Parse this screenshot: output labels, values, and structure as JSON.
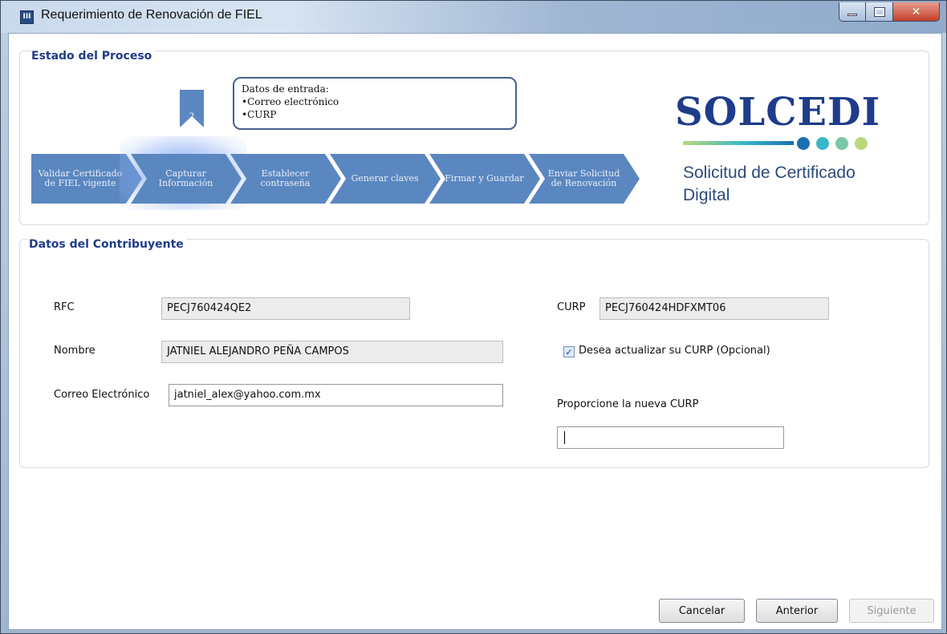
{
  "window": {
    "title": "Requerimiento de Renovación de FIEL",
    "icon_text": "III"
  },
  "process": {
    "group_title": "Estado del Proceso",
    "step_number": "2",
    "callout": {
      "heading": "Datos de entrada:",
      "items": [
        "Correo electrónico",
        "CURP"
      ]
    },
    "steps": [
      {
        "label": "Validar Certificado de FIEL vigente"
      },
      {
        "label": "Capturar Información"
      },
      {
        "label": "Establecer contraseña"
      },
      {
        "label": "Generar claves"
      },
      {
        "label": "Firmar y Guardar"
      },
      {
        "label": "Enviar Solicitud de Renovación"
      }
    ],
    "active_step": 2
  },
  "logo": {
    "word": "SOLCEDI",
    "sub1": "Solicitud de Certificado",
    "sub2": "Digital",
    "dot_colors": [
      "#1b6fb3",
      "#38b7c7",
      "#7cc6a8",
      "#b9d97a"
    ]
  },
  "contribuyente": {
    "group_title": "Datos del Contribuyente",
    "rfc_label": "RFC",
    "rfc_value": "PECJ760424QE2",
    "nombre_label": "Nombre",
    "nombre_value": "JATNIEL ALEJANDRO PEÑA CAMPOS",
    "correo_label": "Correo Electrónico",
    "correo_value": "jatniel_alex@yahoo.com.mx",
    "curp_label": "CURP",
    "curp_value": "PECJ760424HDFXMT06",
    "actualizar_label": "Desea actualizar su CURP (Opcional)",
    "actualizar_checked": true,
    "nueva_curp_label": "Proporcione la nueva CURP",
    "nueva_curp_value": ""
  },
  "buttons": {
    "cancelar": "Cancelar",
    "anterior": "Anterior",
    "siguiente": "Siguiente"
  },
  "colors": {
    "accent": "#1f3c8a",
    "chevron": "#5b87c0"
  }
}
